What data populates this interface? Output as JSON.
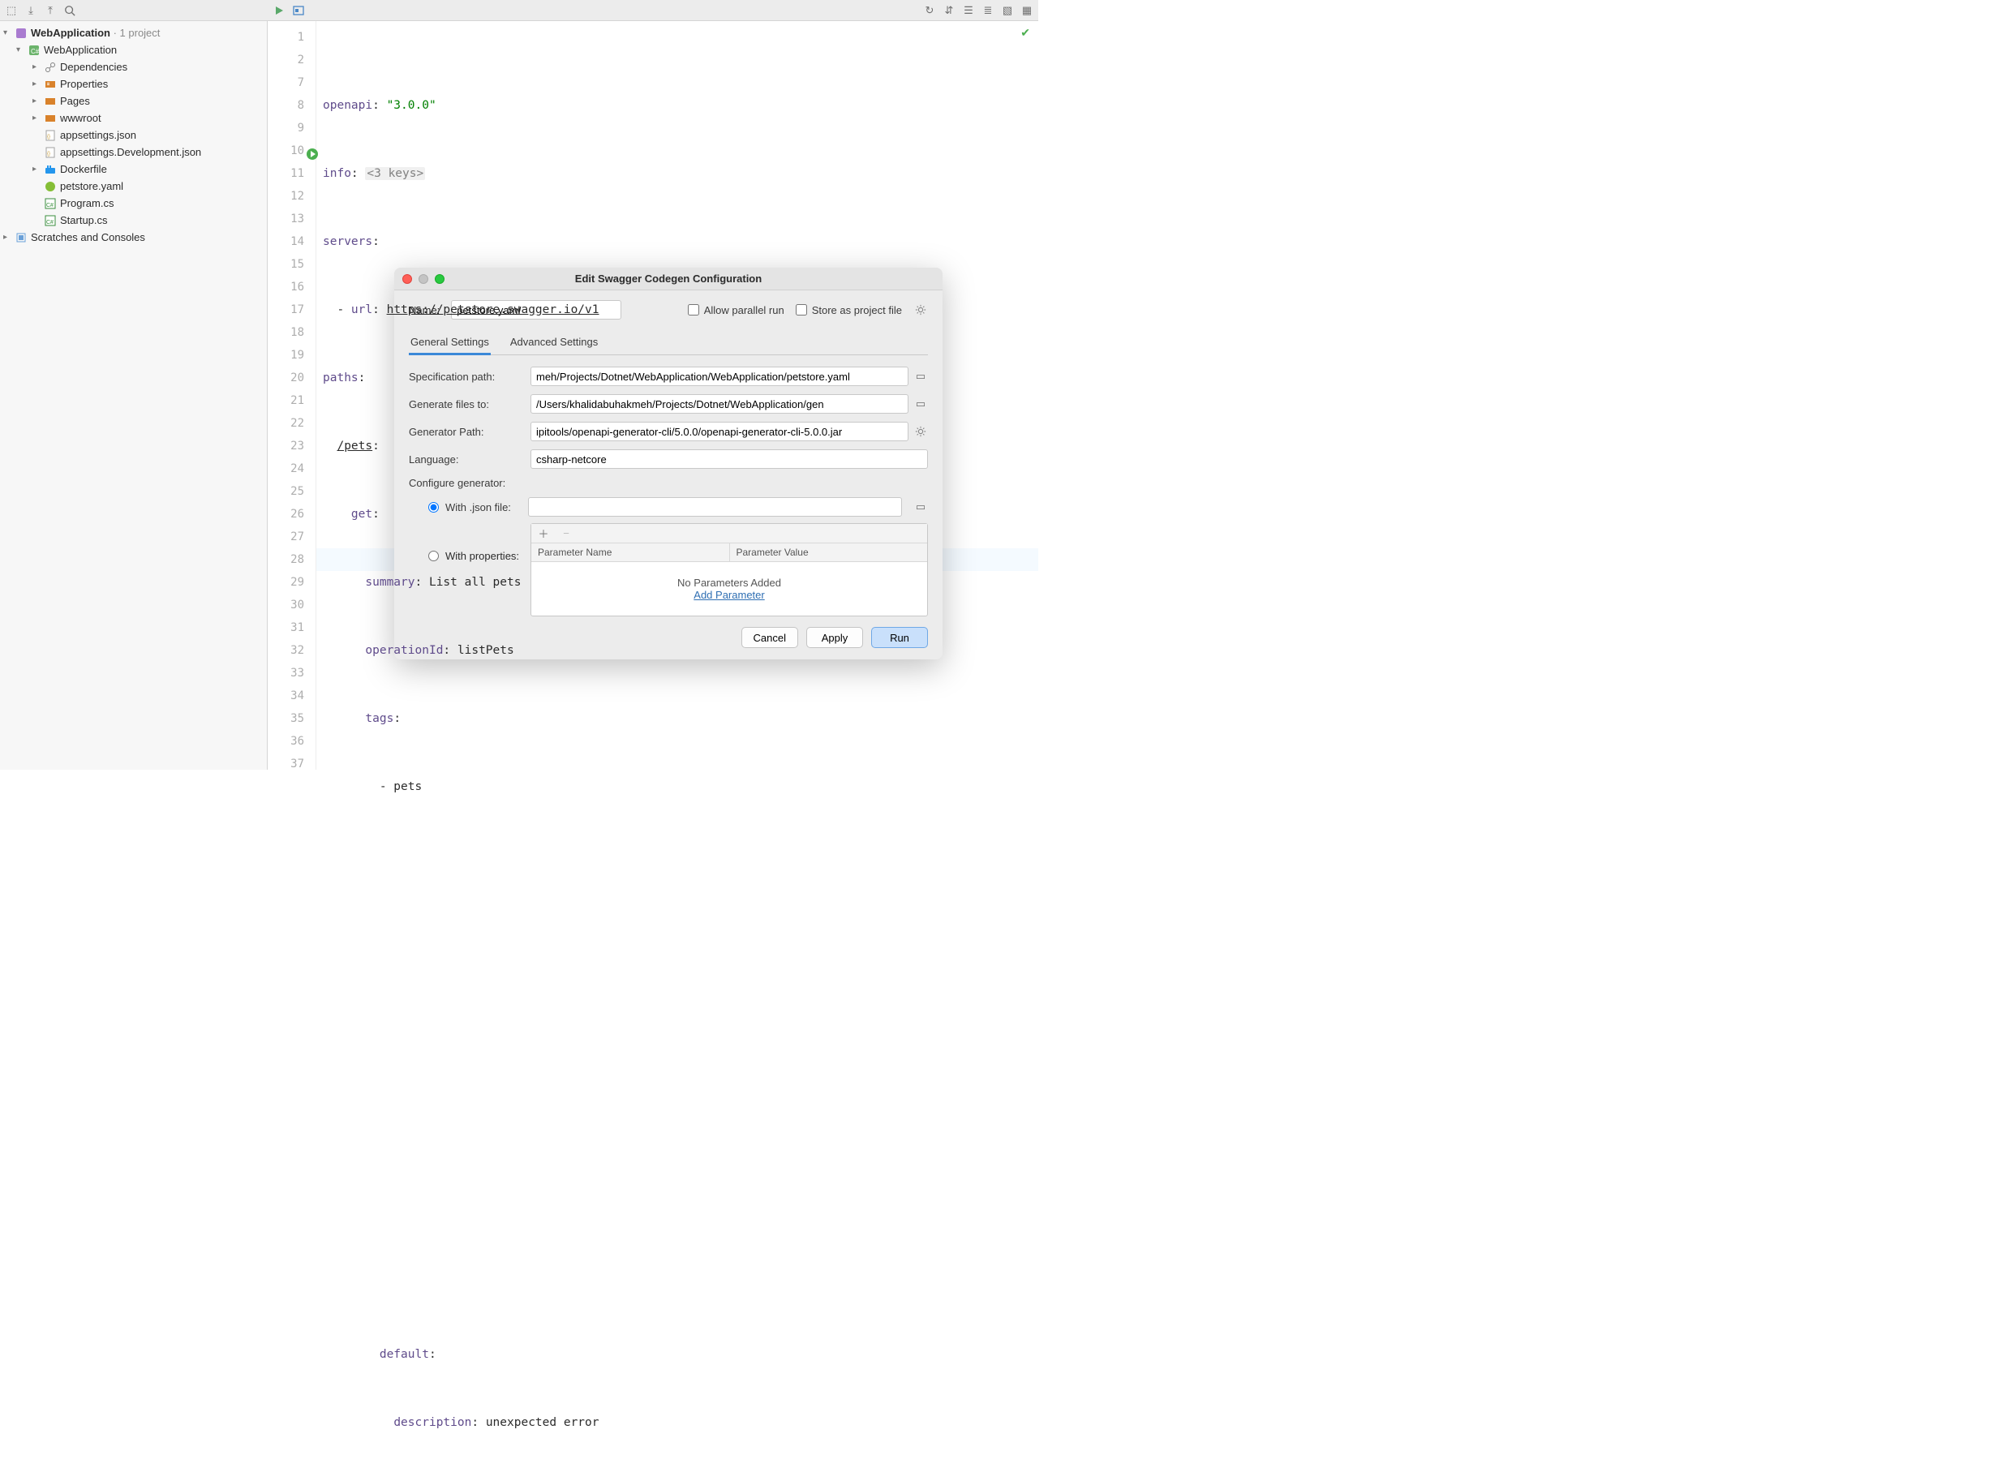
{
  "toolbar": {},
  "sidebar": {
    "root": {
      "name": "WebApplication",
      "suffix": " · 1 project"
    },
    "project": "WebApplication",
    "folders": [
      {
        "name": "Dependencies",
        "icon": "deps"
      },
      {
        "name": "Properties",
        "icon": "props"
      },
      {
        "name": "Pages",
        "icon": "folder"
      },
      {
        "name": "wwwroot",
        "icon": "folder"
      }
    ],
    "files": [
      {
        "name": "appsettings.json",
        "icon": "json"
      },
      {
        "name": "appsettings.Development.json",
        "icon": "json"
      },
      {
        "name": "Dockerfile",
        "icon": "docker",
        "expandable": true
      },
      {
        "name": "petstore.yaml",
        "icon": "yaml"
      },
      {
        "name": "Program.cs",
        "icon": "cs"
      },
      {
        "name": "Startup.cs",
        "icon": "cs"
      }
    ],
    "scratches": "Scratches and Consoles"
  },
  "editor": {
    "lineNumbers": [
      1,
      2,
      7,
      8,
      9,
      10,
      11,
      12,
      13,
      14,
      15,
      16,
      17,
      18,
      19,
      20,
      21,
      22,
      23,
      24,
      25,
      26,
      27,
      28,
      29,
      30,
      31,
      32,
      33,
      34,
      35,
      36,
      37
    ],
    "lines": {
      "l1_key": "openapi",
      "l1_val": "\"3.0.0\"",
      "l2_key": "info",
      "l2_fold": "<3 keys>",
      "l7_key": "servers",
      "l8_key": "url",
      "l8_url": "https://petstore.swagger.io/v1",
      "l9_key": "paths",
      "l10_key": "/pets",
      "l11_key": "get",
      "l12_key": "summary",
      "l12_val": "List all pets",
      "l13_key": "operationId",
      "l13_val": "listPets",
      "l14_key": "tags",
      "l15_val": "- pets",
      "l36_key": "default",
      "l37_key": "description",
      "l37_val": "unexpected error"
    }
  },
  "dialog": {
    "title": "Edit Swagger Codegen Configuration",
    "name_label": "Name:",
    "name_value": "petstore.yaml",
    "allow_parallel": "Allow parallel run",
    "store_as_project": "Store as project file",
    "tabs": {
      "general": "General Settings",
      "advanced": "Advanced Settings"
    },
    "fields": {
      "spec_label": "Specification path:",
      "spec_value": "meh/Projects/Dotnet/WebApplication/WebApplication/petstore.yaml",
      "gen_to_label": "Generate files to:",
      "gen_to_value": "/Users/khalidabuhakmeh/Projects/Dotnet/WebApplication/gen",
      "gen_path_label": "Generator Path:",
      "gen_path_value": "ipitools/openapi-generator-cli/5.0.0/openapi-generator-cli-5.0.0.jar",
      "lang_label": "Language:",
      "lang_value": "csharp-netcore",
      "config_label": "Configure generator:",
      "with_json": "With .json file:",
      "with_props": "With properties:",
      "json_value": ""
    },
    "param_table": {
      "col1": "Parameter Name",
      "col2": "Parameter Value",
      "empty": "No Parameters Added",
      "add_link": "Add Parameter"
    },
    "buttons": {
      "cancel": "Cancel",
      "apply": "Apply",
      "run": "Run"
    }
  }
}
